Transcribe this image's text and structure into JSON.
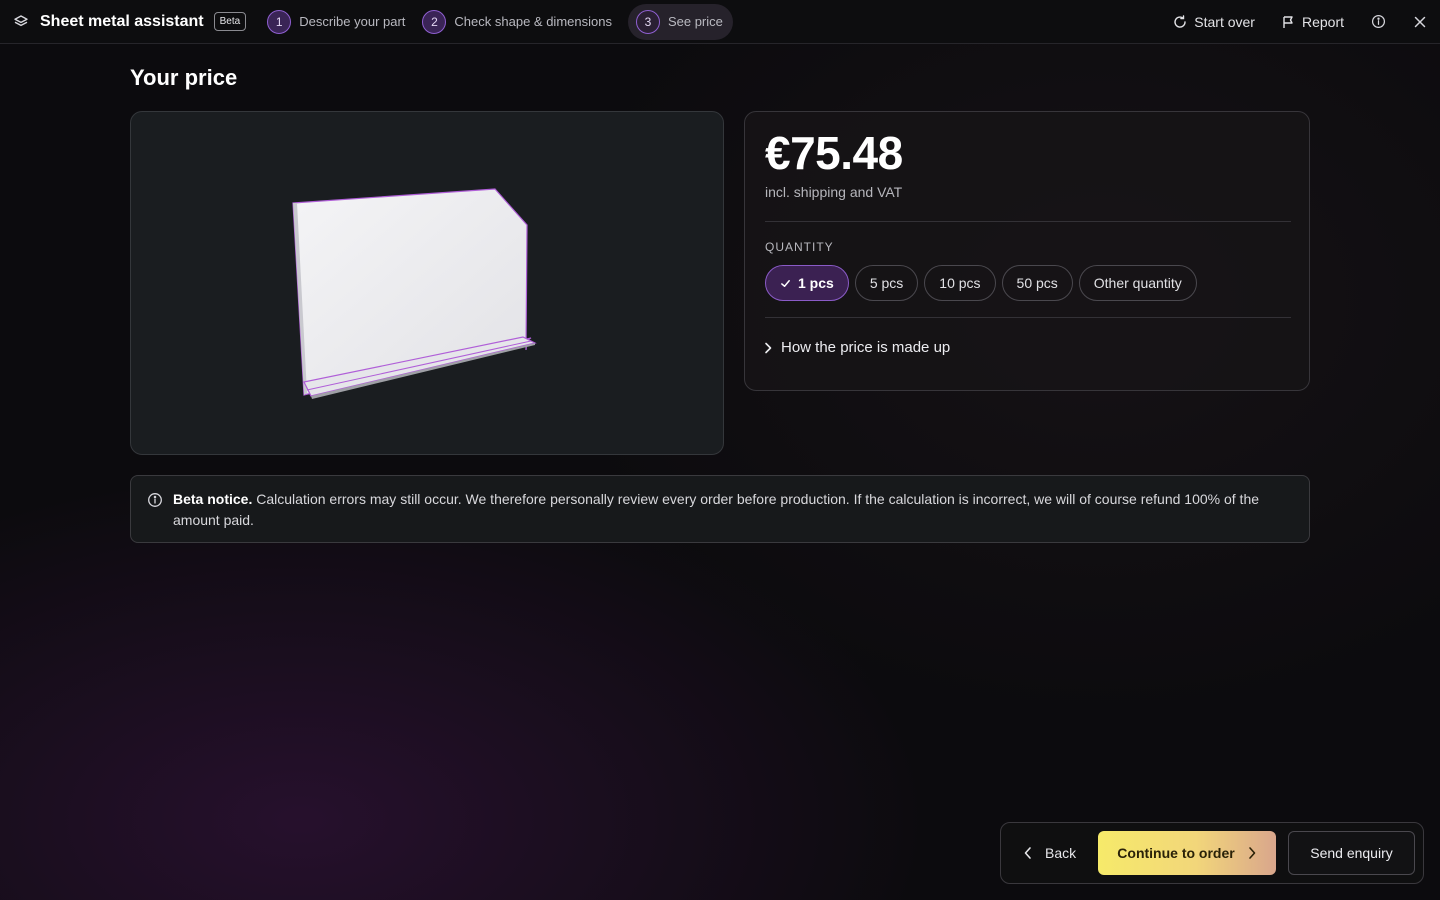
{
  "app": {
    "title": "Sheet metal assistant",
    "badge": "Beta"
  },
  "steps": [
    {
      "number": "1",
      "label": "Describe your part"
    },
    {
      "number": "2",
      "label": "Check shape & dimensions"
    },
    {
      "number": "3",
      "label": "See price",
      "active": true
    }
  ],
  "top_actions": {
    "start_over": "Start over",
    "report": "Report"
  },
  "page": {
    "title": "Your price"
  },
  "price_card": {
    "price": "€75.48",
    "price_note": "incl. shipping and VAT",
    "quantity_label": "QUANTITY",
    "quantities": [
      {
        "label": "1 pcs",
        "selected": true
      },
      {
        "label": "5 pcs"
      },
      {
        "label": "10 pcs"
      },
      {
        "label": "50 pcs"
      },
      {
        "label": "Other quantity"
      }
    ],
    "breakdown_label": "How the price is made up"
  },
  "notice": {
    "title": "Beta notice.",
    "text": "Calculation errors may still occur. We therefore personally review every order before production. If the calculation is incorrect, we will of course refund 100% of the amount paid."
  },
  "actions": {
    "back": "Back",
    "continue": "Continue to order",
    "enquiry": "Send enquiry"
  },
  "colors": {
    "accent_purple": "#8a5bc7",
    "cta_yellow": "#f6ea6a",
    "background": "#0c0b0e"
  }
}
